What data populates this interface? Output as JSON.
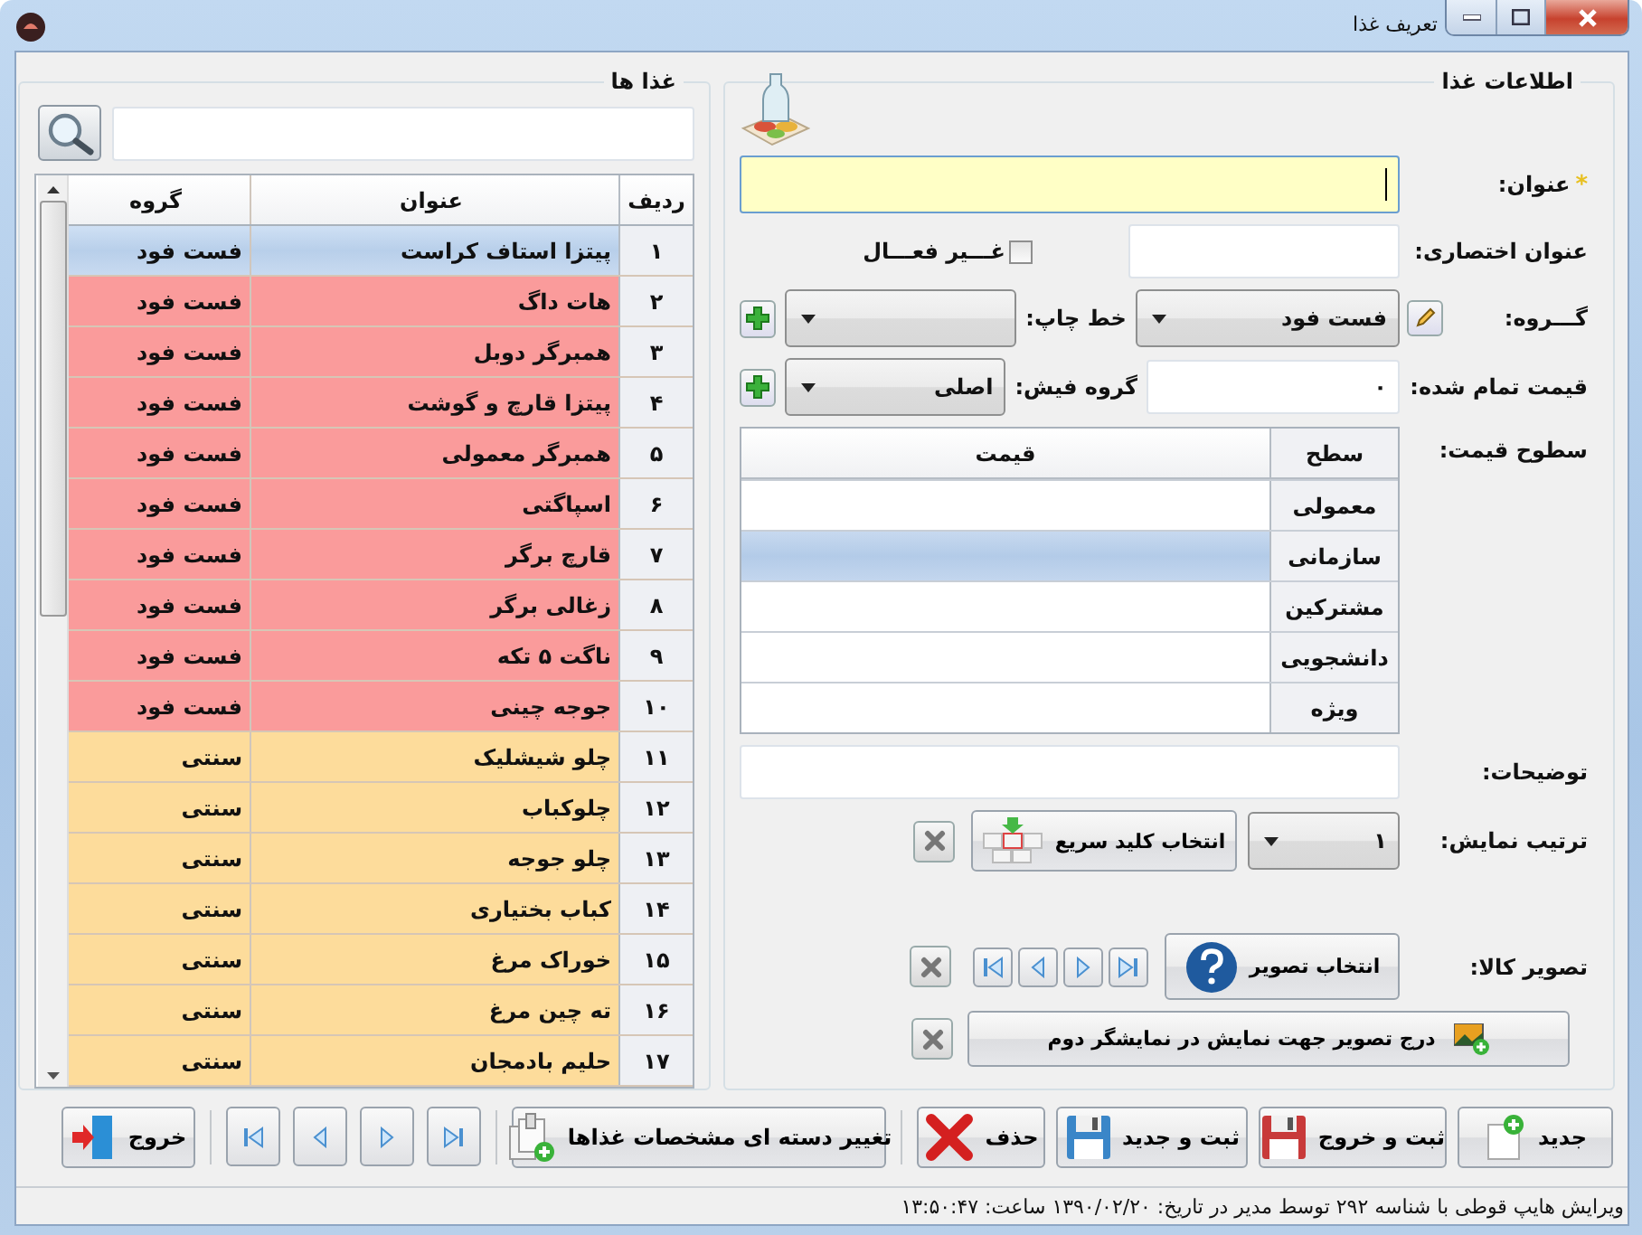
{
  "window": {
    "title": "تعریف غذا"
  },
  "foods_panel": {
    "title": "غذا ها",
    "table": {
      "columns": [
        "ردیف",
        "عنوان",
        "گروه"
      ],
      "rows": [
        {
          "number": "۱",
          "name": "پیتزا استاف کراست",
          "group": "فست فود",
          "selected": true
        },
        {
          "number": "۲",
          "name": "هات داگ",
          "group": "فست فود",
          "color": "#fa9b9b",
          "selected": false
        },
        {
          "number": "۳",
          "name": "همبرگر دوبل",
          "group": "فست فود",
          "color": "#fa9b9b",
          "selected": false
        },
        {
          "number": "۴",
          "name": "پیتزا قارچ و گوشت",
          "group": "فست فود",
          "color": "#fa9b9b",
          "selected": false
        },
        {
          "number": "۵",
          "name": "همبرگر معمولی",
          "group": "فست فود",
          "color": "#fa9b9b",
          "selected": false
        },
        {
          "number": "۶",
          "name": "اسپاگتی",
          "group": "فست فود",
          "color": "#fa9b9b",
          "selected": false
        },
        {
          "number": "۷",
          "name": "قارچ برگر",
          "group": "فست فود",
          "color": "#fa9b9b",
          "selected": false
        },
        {
          "number": "۸",
          "name": "زغالی برگر",
          "group": "فست فود",
          "color": "#fa9b9b",
          "selected": false
        },
        {
          "number": "۹",
          "name": "ناگت ۵ تکه",
          "group": "فست فود",
          "color": "#fa9b9b",
          "selected": false
        },
        {
          "number": "۱۰",
          "name": "جوجه چینی",
          "group": "فست فود",
          "color": "#fa9b9b",
          "selected": false
        },
        {
          "number": "۱۱",
          "name": "چلو شیشلیک",
          "group": "سنتی",
          "color": "#fddc9b",
          "selected": false
        },
        {
          "number": "۱۲",
          "name": "چلوکباب",
          "group": "سنتی",
          "color": "#fddc9b",
          "selected": false
        },
        {
          "number": "۱۳",
          "name": "چلو جوجه",
          "group": "سنتی",
          "color": "#fddc9b",
          "selected": false
        },
        {
          "number": "۱۴",
          "name": "کباب بختیاری",
          "group": "سنتی",
          "color": "#fddc9b",
          "selected": false
        },
        {
          "number": "۱۵",
          "name": "خوراک مرغ",
          "group": "سنتی",
          "color": "#fddc9b",
          "selected": false
        },
        {
          "number": "۱۶",
          "name": "ته چین مرغ",
          "group": "سنتی",
          "color": "#fddc9b",
          "selected": false
        },
        {
          "number": "۱۷",
          "name": "حلیم بادمجان",
          "group": "سنتی",
          "color": "#fddc9b",
          "selected": false
        }
      ]
    }
  },
  "info_panel": {
    "title": "اطلاعات غذا",
    "title_field": {
      "label": "عنوان:",
      "required_mark": "*",
      "focused": true
    },
    "short_title_field": {
      "label": "عنوان اختصاری:"
    },
    "inactive_checkbox": {
      "label": "غـــیر فعـــال",
      "checked": false
    },
    "group_field": {
      "label": "گـــروه:",
      "value": "فست فود"
    },
    "print_line_field": {
      "label": "خط چاپ:"
    },
    "cost_field": {
      "label": "قیمت تمام شده:",
      "value": "۰"
    },
    "receipt_group_field": {
      "label": "گروه فیش:",
      "value": "اصلی"
    },
    "price_levels": {
      "label": "سطوح قیمت:",
      "columns": [
        "سطح",
        "قیمت"
      ],
      "rows": [
        {
          "name": "معمولی",
          "selected": false
        },
        {
          "name": "سازمانی",
          "selected": true
        },
        {
          "name": "مشترکین",
          "selected": false
        },
        {
          "name": "دانشجویی",
          "selected": false
        },
        {
          "name": "ویژه",
          "selected": false
        }
      ]
    },
    "description_field": {
      "label": "توضیحات:"
    },
    "display_order": {
      "label": "ترتیب نمایش:",
      "value": "۱",
      "shortcut_button": "انتخاب کلید سریع"
    },
    "image": {
      "label": "تصویر کالا:",
      "choose_button": "انتخاب تصویر",
      "second_display_button": "درج تصویر جهت نمایش در نمایشگر دوم"
    }
  },
  "toolbar": {
    "actions": [
      {
        "kind": "new",
        "label": "جدید"
      },
      {
        "kind": "save_exit",
        "label": "ثبت و خروج"
      },
      {
        "kind": "save_new",
        "label": "ثبت و جدید"
      },
      {
        "kind": "delete",
        "label": "حذف"
      },
      {
        "kind": "batch_edit",
        "label": "تغییر دسته ای مشخصات غذاها"
      }
    ],
    "exit_button": "خروج"
  },
  "status_bar": {
    "text": "ویرایش هایپ قوطی با شناسه ۲۹۲ توسط مدیر در تاریخ: ۱۳۹۰/۰۲/۲۰ ساعت: ۱۳:۵۰:۴۷"
  }
}
